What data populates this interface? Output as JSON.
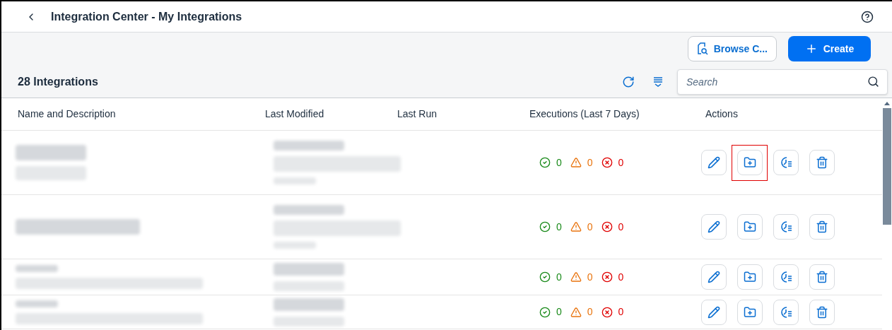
{
  "header": {
    "title": "Integration Center - My Integrations"
  },
  "toolbar": {
    "browse_button": "Browse C...",
    "create_button": "Create",
    "count": "28 Integrations",
    "search": {
      "placeholder": "Search"
    }
  },
  "table": {
    "columns": [
      "Name and Description",
      "Last Modified",
      "Last Run",
      "Executions (Last 7 Days)",
      "Actions"
    ],
    "rows": [
      {
        "kind": "tall",
        "success": "0",
        "warnings": "0",
        "errors": "0",
        "actions": [
          {
            "highlighted": false
          },
          {
            "highlighted": true
          },
          {
            "highlighted": false
          },
          {
            "highlighted": false
          }
        ]
      },
      {
        "kind": "tall",
        "success": "0",
        "warnings": "0",
        "errors": "0",
        "actions": [
          {
            "highlighted": false
          },
          {
            "highlighted": false
          },
          {
            "highlighted": false
          },
          {
            "highlighted": false
          }
        ]
      },
      {
        "kind": "compact",
        "success": "0",
        "warnings": "0",
        "errors": "0",
        "actions": [
          {
            "highlighted": false
          },
          {
            "highlighted": false
          },
          {
            "highlighted": false
          },
          {
            "highlighted": false
          }
        ]
      },
      {
        "kind": "compact",
        "success": "0",
        "warnings": "0",
        "errors": "0",
        "actions": [
          {
            "highlighted": false
          },
          {
            "highlighted": false
          },
          {
            "highlighted": false
          },
          {
            "highlighted": false
          }
        ]
      }
    ]
  }
}
